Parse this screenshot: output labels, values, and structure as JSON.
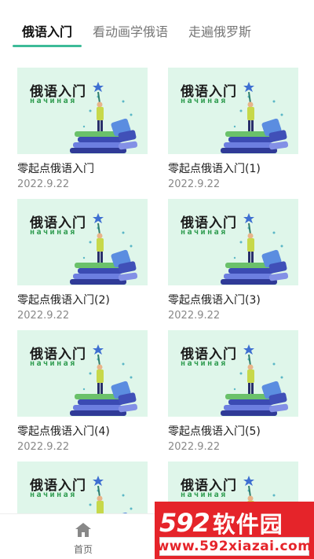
{
  "tabs": [
    {
      "label": "俄语入门",
      "active": true
    },
    {
      "label": "看动画学俄语",
      "active": false
    },
    {
      "label": "走遍俄罗斯",
      "active": false
    }
  ],
  "thumbnail": {
    "title": "俄语入门",
    "subtitle": "начиная"
  },
  "cards": [
    {
      "title": "零起点俄语入门",
      "date": "2022.9.22"
    },
    {
      "title": "零起点俄语入门(1)",
      "date": "2022.9.22"
    },
    {
      "title": "零起点俄语入门(2)",
      "date": "2022.9.22"
    },
    {
      "title": "零起点俄语入门(3)",
      "date": "2022.9.22"
    },
    {
      "title": "零起点俄语入门(4)",
      "date": "2022.9.22"
    },
    {
      "title": "零起点俄语入门(5)",
      "date": "2022.9.22"
    },
    {
      "title": "",
      "date": ""
    },
    {
      "title": "",
      "date": ""
    }
  ],
  "bottom_nav": {
    "home_label": "首页",
    "home_icon": "home-icon"
  },
  "watermark": {
    "brand": "592",
    "brand_zh": "软件园",
    "url": "www.592xiazai.com"
  },
  "colors": {
    "accent": "#3dbb98",
    "thumb_bg": "#dff6ea",
    "watermark_red": "#e5242a"
  }
}
